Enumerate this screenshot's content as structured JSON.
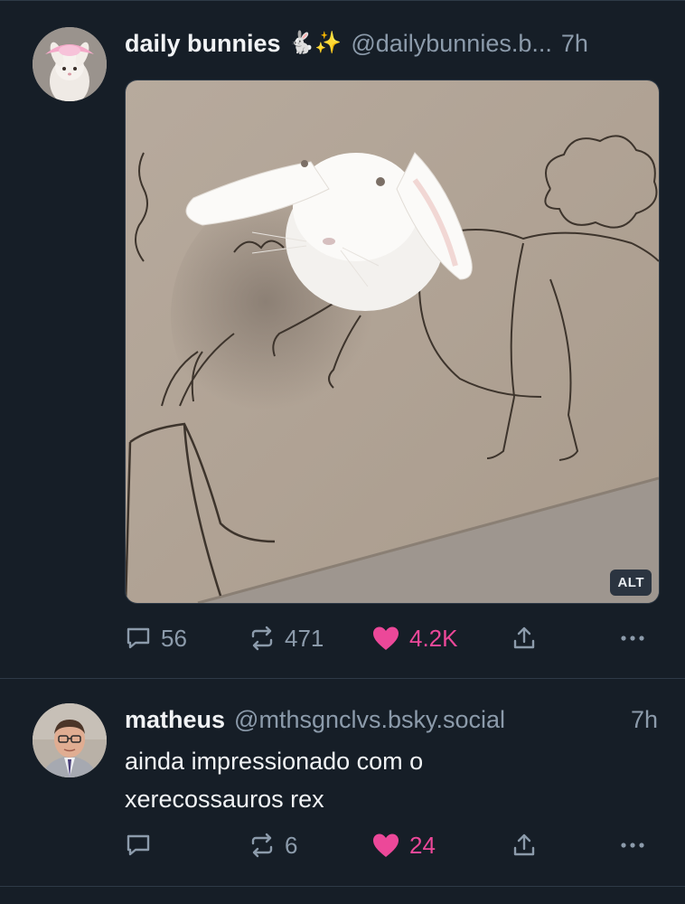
{
  "posts": [
    {
      "author_name": "daily bunnies",
      "author_emoji": "🐇✨",
      "handle": "@dailybunnies.b...",
      "separator": "",
      "time": "7h",
      "image_alt_badge": "ALT",
      "actions": {
        "replies": "56",
        "reposts": "471",
        "likes": "4.2K",
        "liked": true
      }
    },
    {
      "author_name": "matheus",
      "handle": "@mthsgnclvs.bsky.social",
      "time": "7h",
      "text_line1": "ainda impressionado com o",
      "text_line2": "xerecossauros rex",
      "actions": {
        "replies": "",
        "reposts": "6",
        "likes": "24",
        "liked": true
      }
    }
  ],
  "colors": {
    "background": "#161e27",
    "muted": "#8c9bab",
    "like": "#ec4899",
    "divider": "#2e3a47"
  },
  "icons": [
    "reply-icon",
    "repost-icon",
    "like-heart-icon",
    "share-icon",
    "more-icon"
  ]
}
